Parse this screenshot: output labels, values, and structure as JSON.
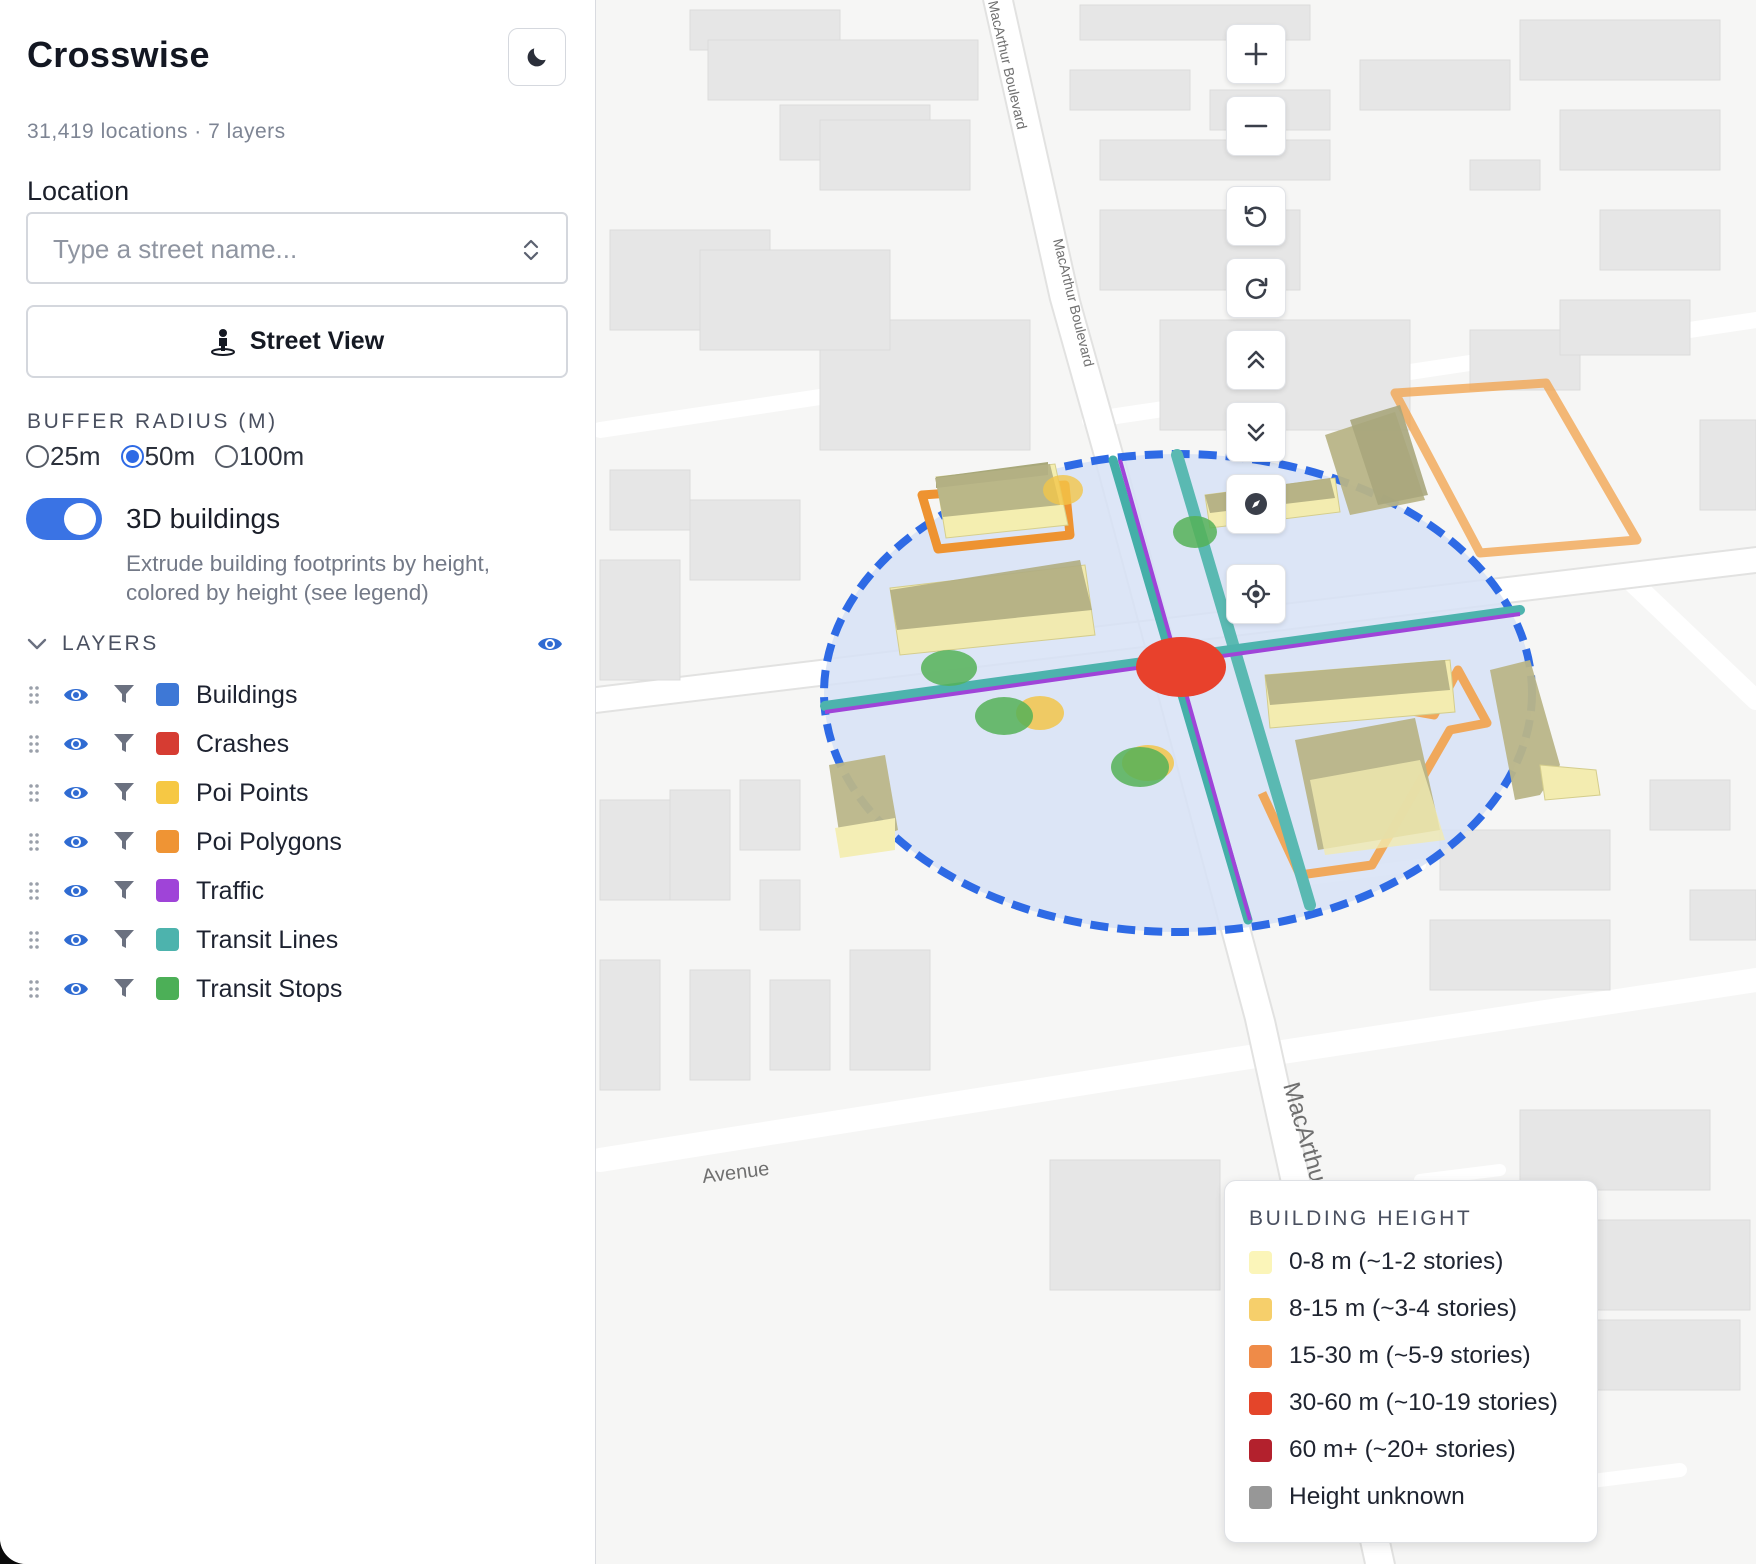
{
  "app": {
    "title": "Crosswise",
    "stats": "31,419 locations · 7 layers"
  },
  "location": {
    "label": "Location",
    "placeholder": "Type a street name..."
  },
  "street_view": {
    "label": "Street View"
  },
  "buffer": {
    "title": "BUFFER RADIUS (M)",
    "options": [
      "25m",
      "50m",
      "100m"
    ],
    "selected": "50m"
  },
  "buildings3d": {
    "label": "3D buildings",
    "enabled": true,
    "description": "Extrude building footprints by height, colored by height (see legend)"
  },
  "layers": {
    "title": "LAYERS",
    "items": [
      {
        "name": "Buildings",
        "color": "#3e78d6"
      },
      {
        "name": "Crashes",
        "color": "#d63c32"
      },
      {
        "name": "Poi Points",
        "color": "#f6c844"
      },
      {
        "name": "Poi Polygons",
        "color": "#ef9434"
      },
      {
        "name": "Traffic",
        "color": "#9f44d8"
      },
      {
        "name": "Transit Lines",
        "color": "#4db3ad"
      },
      {
        "name": "Transit Stops",
        "color": "#4caf57"
      }
    ]
  },
  "map": {
    "street_labels": [
      "MacArthur Boulevard",
      "MacArthur Boulevard",
      "MacArthur Boulevard",
      "Avenue"
    ],
    "controls": [
      "zoom-in-icon",
      "zoom-out-icon",
      "rotate-left-icon",
      "rotate-right-icon",
      "pitch-up-icon",
      "pitch-down-icon",
      "compass-icon",
      "locate-icon"
    ]
  },
  "legend": {
    "title": "BUILDING HEIGHT",
    "items": [
      {
        "label": "0-8 m (~1-2 stories)",
        "color": "#fbf5b9"
      },
      {
        "label": "8-15 m (~3-4 stories)",
        "color": "#f6cf6b"
      },
      {
        "label": "15-30 m (~5-9 stories)",
        "color": "#ef8b48"
      },
      {
        "label": "30-60 m (~10-19 stories)",
        "color": "#e4452a"
      },
      {
        "label": "60 m+ (~20+ stories)",
        "color": "#b3212d"
      },
      {
        "label": "Height unknown",
        "color": "#979797"
      }
    ]
  }
}
